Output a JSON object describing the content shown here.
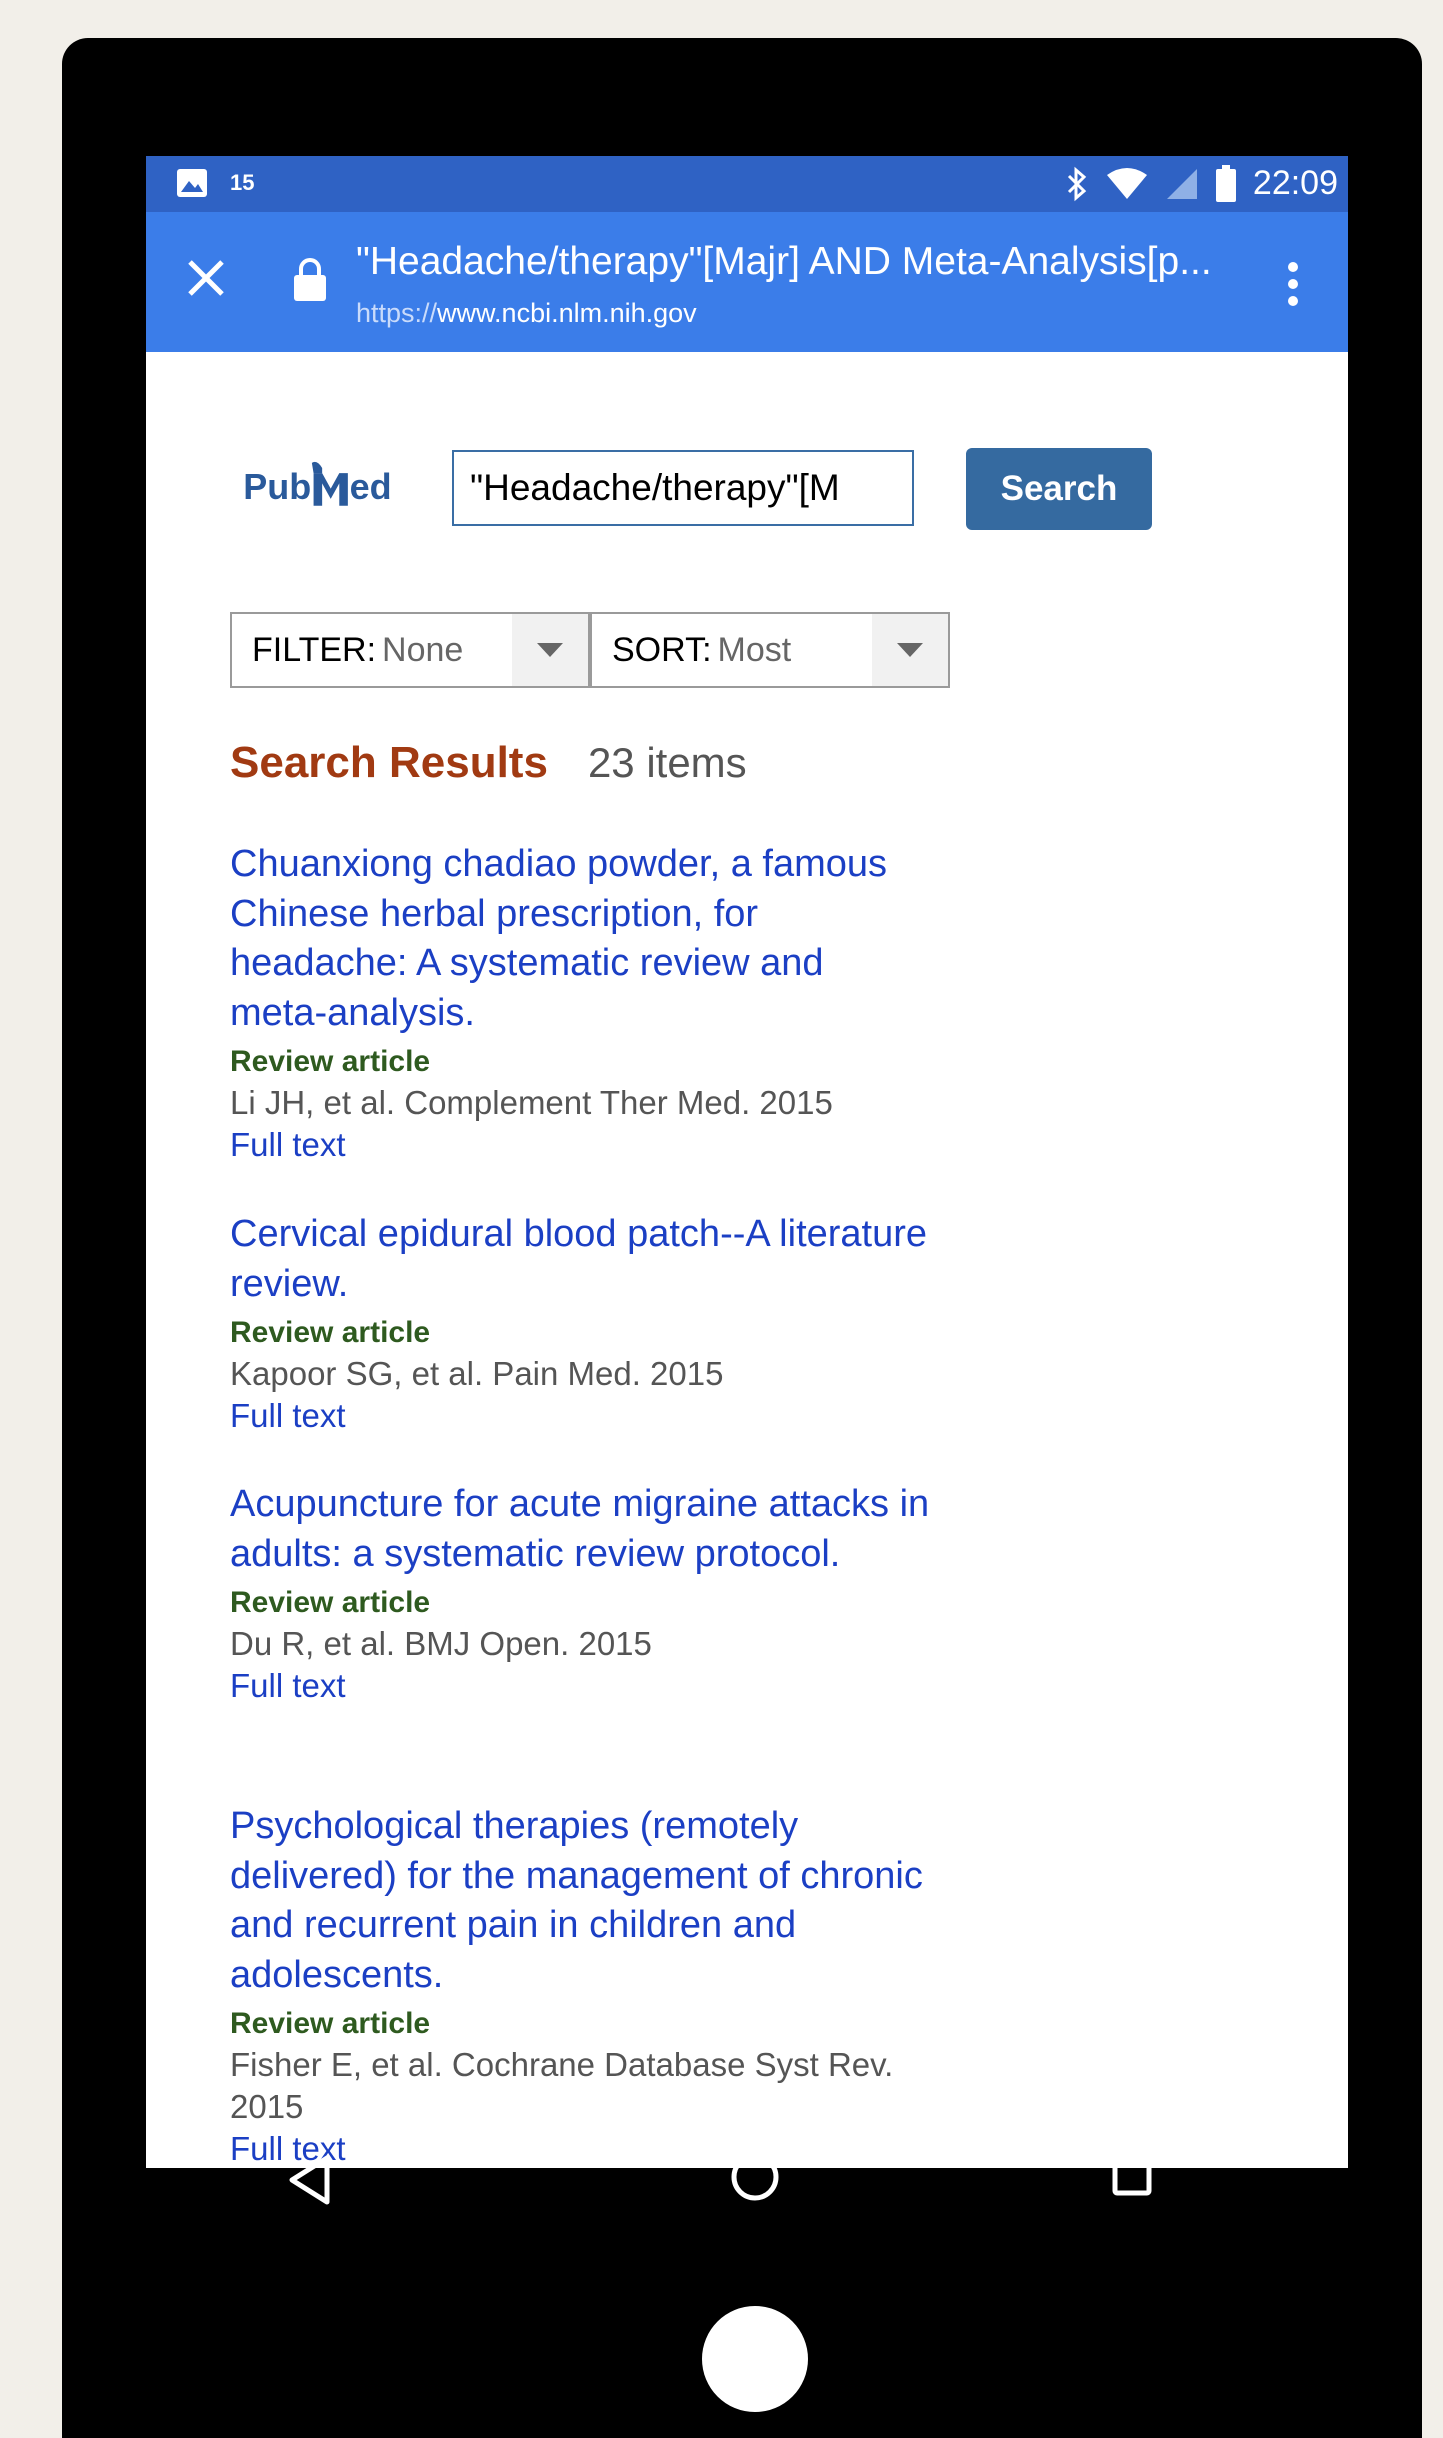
{
  "status_bar": {
    "notification_count": "15",
    "time": "22:09",
    "icons": [
      "image-icon",
      "bluetooth-icon",
      "wifi-icon",
      "cell-signal-icon",
      "battery-icon"
    ]
  },
  "browser": {
    "tab_title": "\"Headache/therapy\"[Majr] AND Meta-Analysis[p...",
    "url_scheme": "https://",
    "url_host": "www.ncbi.nlm.nih.gov",
    "accent_color": "#3b7de9"
  },
  "search": {
    "logo_text_a": "Pub",
    "logo_text_b": "ed",
    "query_value": "\"Headache/therapy\"[M",
    "button_label": "Search"
  },
  "filters": {
    "filter_label": "FILTER:",
    "filter_value": "None",
    "sort_label": "SORT:",
    "sort_value": "Most"
  },
  "results": {
    "title": "Search Results",
    "count": "23 items",
    "items": [
      {
        "title": "Chuanxiong chadiao powder, a famous Chinese herbal prescription, for headache: A systematic review and meta-analysis.",
        "type": "Review article",
        "citation": "Li JH, et al. Complement Ther Med. 2015",
        "link": "Full text"
      },
      {
        "title": "Cervical epidural blood patch--A literature review.",
        "type": "Review article",
        "citation": "Kapoor SG, et al. Pain Med. 2015",
        "link": "Full text"
      },
      {
        "title": "Acupuncture for acute migraine attacks in adults: a systematic review protocol.",
        "type": "Review article",
        "citation": "Du R, et al. BMJ Open. 2015",
        "link": "Full text"
      },
      {
        "title": "Psychological therapies (remotely delivered) for the management of chronic and recurrent pain in children and adolescents.",
        "type": "Review article",
        "citation": "Fisher E, et al. Cochrane Database Syst Rev. 2015",
        "link": "Full text"
      }
    ]
  }
}
